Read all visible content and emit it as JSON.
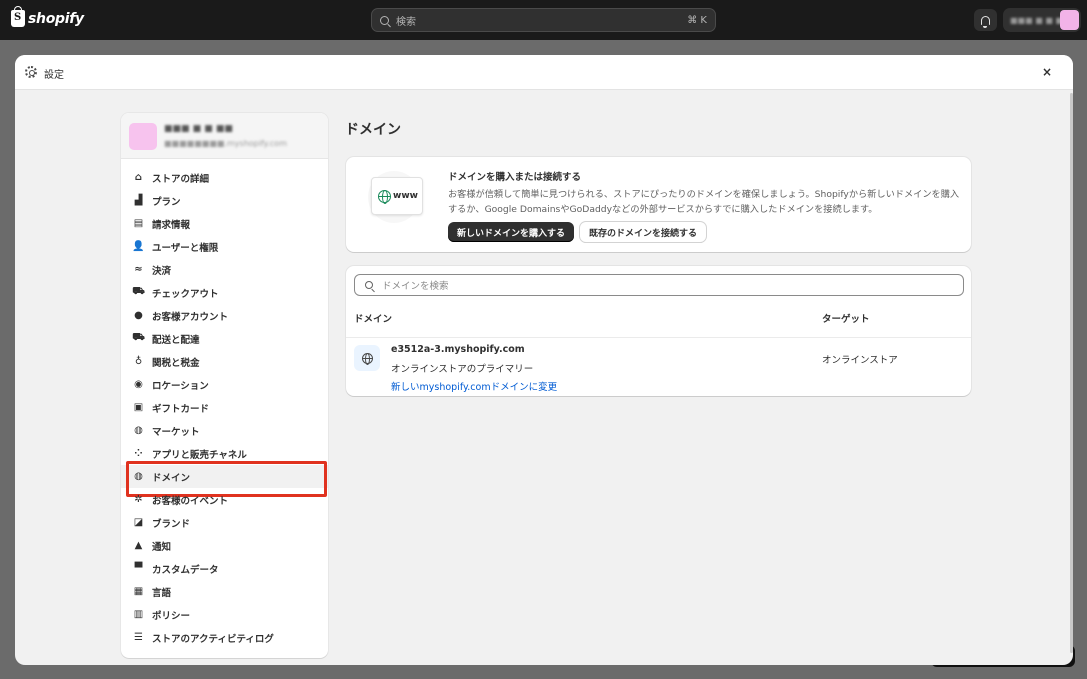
{
  "topbar": {
    "logo_text": "shopify",
    "search_placeholder": "検索",
    "search_shortcut": "⌘ K",
    "store_name": "■■■ ■ ■ ■■",
    "icons": [
      "shopify-bag-icon",
      "search-icon",
      "bell-icon"
    ]
  },
  "modal": {
    "title": "設定",
    "close_label": "×"
  },
  "sidebar": {
    "store_name": "■■■ ■ ■ ■■",
    "store_domain": "■■■■■■■■.myshopify.com",
    "items": [
      {
        "label": "ストアの詳細",
        "icon": "store-icon",
        "glyph": "⌂"
      },
      {
        "label": "プラン",
        "icon": "plan-icon",
        "glyph": "▟"
      },
      {
        "label": "請求情報",
        "icon": "billing-icon",
        "glyph": "▤"
      },
      {
        "label": "ユーザーと権限",
        "icon": "users-icon",
        "glyph": "👤"
      },
      {
        "label": "決済",
        "icon": "payments-icon",
        "glyph": "≈"
      },
      {
        "label": "チェックアウト",
        "icon": "cart-icon",
        "glyph": "⛟"
      },
      {
        "label": "お客様アカウント",
        "icon": "customer-icon",
        "glyph": "●"
      },
      {
        "label": "配送と配達",
        "icon": "truck-icon",
        "glyph": "⛟"
      },
      {
        "label": "関税と税金",
        "icon": "tax-icon",
        "glyph": "♁"
      },
      {
        "label": "ロケーション",
        "icon": "location-icon",
        "glyph": "◉"
      },
      {
        "label": "ギフトカード",
        "icon": "gift-card-icon",
        "glyph": "▣"
      },
      {
        "label": "マーケット",
        "icon": "globe-icon",
        "glyph": "◍"
      },
      {
        "label": "アプリと販売チャネル",
        "icon": "apps-icon",
        "glyph": "⁘"
      },
      {
        "label": "ドメイン",
        "icon": "domain-globe-icon",
        "glyph": "◍"
      },
      {
        "label": "お客様のイベント",
        "icon": "events-icon",
        "glyph": "✲"
      },
      {
        "label": "ブランド",
        "icon": "brand-icon",
        "glyph": "◪"
      },
      {
        "label": "通知",
        "icon": "bell-icon",
        "glyph": "▲"
      },
      {
        "label": "カスタムデータ",
        "icon": "custom-data-icon",
        "glyph": "▀"
      },
      {
        "label": "言語",
        "icon": "language-icon",
        "glyph": "▦"
      },
      {
        "label": "ポリシー",
        "icon": "policy-icon",
        "glyph": "▥"
      },
      {
        "label": "ストアのアクティビティログ",
        "icon": "activity-log-icon",
        "glyph": "☰"
      }
    ],
    "active_index": 13
  },
  "main": {
    "title": "ドメイン",
    "buy_card": {
      "illustration_text": "www",
      "title": "ドメインを購入または接続する",
      "description": "お客様が信頼して簡単に見つけられる、ストアにぴったりのドメインを確保しましょう。Shopifyから新しいドメインを購入するか、Google DomainsやGoDaddyなどの外部サービスからすでに購入したドメインを接続します。",
      "buy_button": "新しいドメインを購入する",
      "connect_button": "既存のドメインを接続する"
    },
    "domains": {
      "search_placeholder": "ドメインを検索",
      "columns": [
        "ドメイン",
        "ターゲット"
      ],
      "rows": [
        {
          "domain": "e3512a-3.myshopify.com",
          "subtitle": "オンラインストアのプライマリー",
          "link": "新しいmyshopify.comドメインに変更",
          "target": "オンラインストア"
        }
      ]
    }
  },
  "colors": {
    "topbar_bg": "#1a1a1a",
    "highlight_border": "#e0321f",
    "link": "#005bd3",
    "primary_button": "#303030"
  }
}
